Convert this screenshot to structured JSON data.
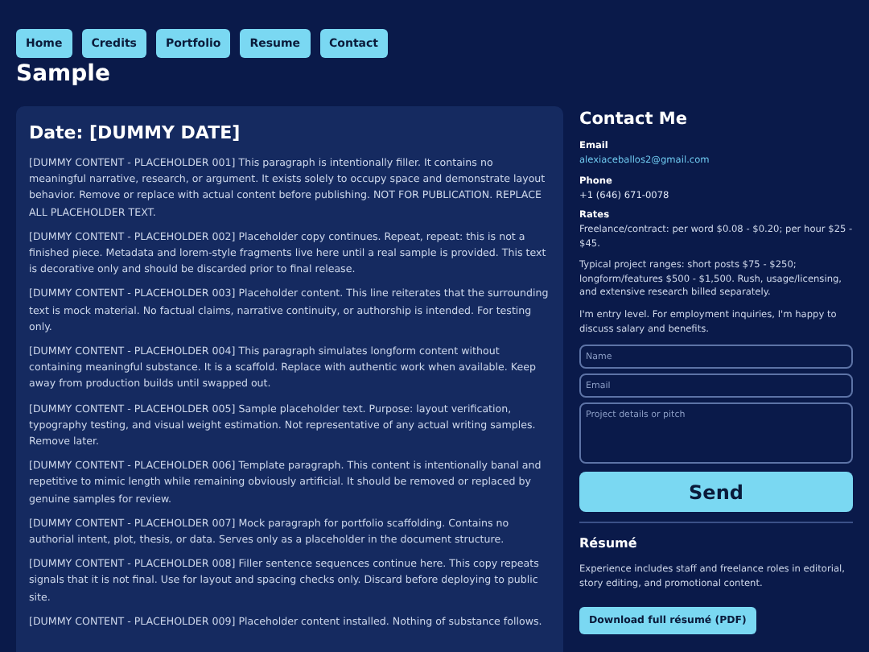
{
  "nav": [
    "Home",
    "Credits",
    "Portfolio",
    "Resume",
    "Contact"
  ],
  "page_title": "Sample",
  "article": {
    "date": "Date: [DUMMY DATE]",
    "paragraphs": [
      "[DUMMY CONTENT - PLACEHOLDER 001] This paragraph is intentionally filler. It contains no meaningful narrative, research, or argument. It exists solely to occupy space and demonstrate layout behavior. Remove or replace with actual content before publishing. NOT FOR PUBLICATION. REPLACE ALL PLACEHOLDER TEXT.",
      "[DUMMY CONTENT - PLACEHOLDER 002] Placeholder copy continues. Repeat, repeat: this is not a finished piece. Metadata and lorem-style fragments live here until a real sample is provided. This text is decorative only and should be discarded prior to final release.",
      "[DUMMY CONTENT - PLACEHOLDER 003] Placeholder content. This line reiterates that the surrounding text is mock material. No factual claims, narrative continuity, or authorship is intended. For testing only.",
      "[DUMMY CONTENT - PLACEHOLDER 004] This paragraph simulates longform content without containing meaningful substance. It is a scaffold. Replace with authentic work when available. Keep away from production builds until swapped out.",
      "[DUMMY CONTENT - PLACEHOLDER 005] Sample placeholder text. Purpose: layout verification, typography testing, and visual weight estimation. Not representative of any actual writing samples. Remove later.",
      "[DUMMY CONTENT - PLACEHOLDER 006] Template paragraph. This content is intentionally banal and repetitive to mimic length while remaining obviously artificial. It should be removed or replaced by genuine samples for review.",
      "[DUMMY CONTENT - PLACEHOLDER 007] Mock paragraph for portfolio scaffolding. Contains no authorial intent, plot, thesis, or data. Serves only as a placeholder in the document structure.",
      "[DUMMY CONTENT - PLACEHOLDER 008] Filler sentence sequences continue here. This copy repeats signals that it is not final. Use for layout and spacing checks only. Discard before deploying to public site.",
      "[DUMMY CONTENT - PLACEHOLDER 009] Placeholder content installed. Nothing of substance follows."
    ]
  },
  "contact": {
    "title": "Contact Me",
    "email_label": "Email",
    "email": "alexiaceballos2@gmail.com",
    "phone_label": "Phone",
    "phone": "+1 (646) 671-0078",
    "rates_label": "Rates",
    "rates": [
      "Freelance/contract: per word $0.08 - $0.20; per hour $25 - $45.",
      "Typical project ranges: short posts $75 - $250; longform/features $500 - $1,500. Rush, usage/licensing, and extensive research billed separately.",
      "I'm entry level. For employment inquiries, I'm happy to discuss salary and benefits."
    ],
    "name_placeholder": "Name",
    "email_placeholder": "Email",
    "message_placeholder": "Project details or pitch",
    "send": "Send"
  },
  "resume": {
    "title": "Résumé",
    "text": "Experience includes staff and freelance roles in editorial, story editing, and promotional content.",
    "download": "Download full résumé (PDF)"
  }
}
